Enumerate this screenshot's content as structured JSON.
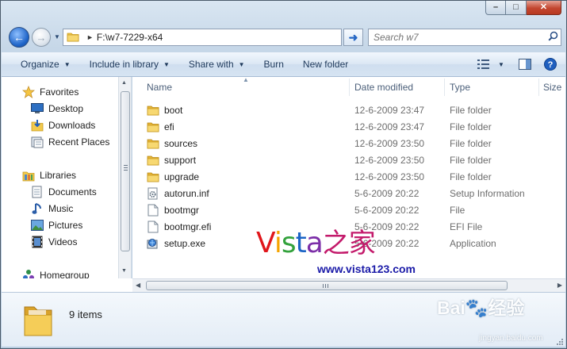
{
  "window": {
    "caption_buttons": {
      "minimize": "–",
      "maximize": "□",
      "close": "✕"
    }
  },
  "nav": {
    "address": "F:\\w7-7229-x64",
    "search_placeholder": "Search w7"
  },
  "toolbar": {
    "organize": "Organize",
    "include_in_library": "Include in library",
    "share_with": "Share with",
    "burn": "Burn",
    "new_folder": "New folder"
  },
  "sidebar": {
    "favorites_label": "Favorites",
    "favorites": [
      {
        "label": "Desktop",
        "icon": "desktop-icon"
      },
      {
        "label": "Downloads",
        "icon": "downloads-icon"
      },
      {
        "label": "Recent Places",
        "icon": "recent-places-icon"
      }
    ],
    "libraries_label": "Libraries",
    "libraries": [
      {
        "label": "Documents",
        "icon": "documents-icon"
      },
      {
        "label": "Music",
        "icon": "music-icon"
      },
      {
        "label": "Pictures",
        "icon": "pictures-icon"
      },
      {
        "label": "Videos",
        "icon": "videos-icon"
      }
    ],
    "homegroup_label": "Homegroup"
  },
  "columns": {
    "name": "Name",
    "date": "Date modified",
    "type": "Type",
    "size": "Size"
  },
  "files": [
    {
      "name": "boot",
      "date": "12-6-2009 23:47",
      "type": "File folder",
      "icon": "folder-icon"
    },
    {
      "name": "efi",
      "date": "12-6-2009 23:47",
      "type": "File folder",
      "icon": "folder-icon"
    },
    {
      "name": "sources",
      "date": "12-6-2009 23:50",
      "type": "File folder",
      "icon": "folder-icon"
    },
    {
      "name": "support",
      "date": "12-6-2009 23:50",
      "type": "File folder",
      "icon": "folder-icon"
    },
    {
      "name": "upgrade",
      "date": "12-6-2009 23:50",
      "type": "File folder",
      "icon": "folder-icon"
    },
    {
      "name": "autorun.inf",
      "date": "5-6-2009 20:22",
      "type": "Setup Information",
      "icon": "setup-info-icon"
    },
    {
      "name": "bootmgr",
      "date": "5-6-2009 20:22",
      "type": "File",
      "icon": "file-icon"
    },
    {
      "name": "bootmgr.efi",
      "date": "5-6-2009 20:22",
      "type": "EFI File",
      "icon": "file-icon"
    },
    {
      "name": "setup.exe",
      "date": "5-6-2009 20:22",
      "type": "Application",
      "icon": "setup-exe-icon"
    }
  ],
  "details": {
    "item_count": "9 items"
  },
  "watermarks": {
    "vista_latin": [
      "V",
      "i",
      "s",
      "t",
      "a"
    ],
    "vista_cn": "之家",
    "vista_url": "www.vista123.com",
    "baidu_logo": "Bai🐾经验",
    "baidu_url": "jingyan.baidu.com"
  },
  "colors": {
    "accent": "#1e395b",
    "folder_yellow": "#f2c94c",
    "selection_blue": "#cce8ff"
  }
}
